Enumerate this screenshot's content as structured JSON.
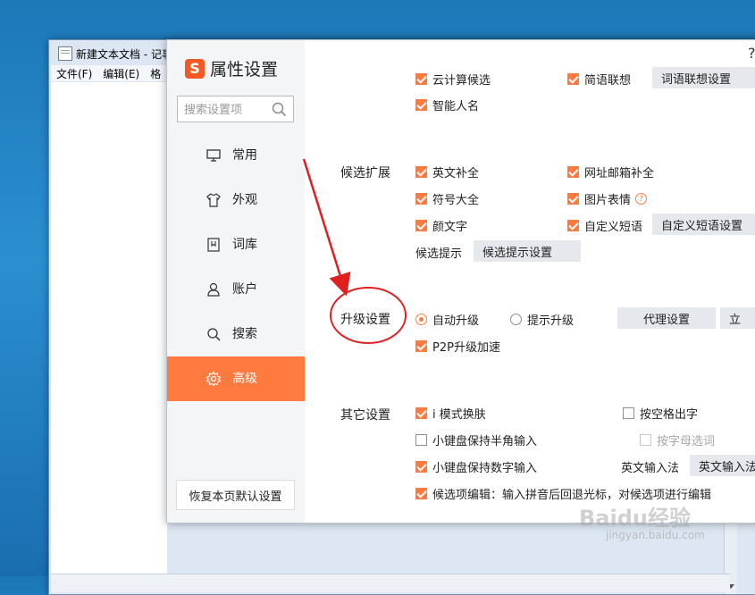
{
  "notepad": {
    "title": "新建文本文档 - 记事",
    "menu": [
      "文件(F)",
      "编辑(E)",
      "格"
    ]
  },
  "dialog": {
    "brand_letter": "S",
    "title": "属性设置",
    "help_glyph": "?",
    "search_placeholder": "搜索设置项",
    "nav": [
      {
        "label": "常用",
        "icon": "monitor-icon"
      },
      {
        "label": "外观",
        "icon": "shirt-icon"
      },
      {
        "label": "词库",
        "icon": "book-icon"
      },
      {
        "label": "账户",
        "icon": "user-icon"
      },
      {
        "label": "搜索",
        "icon": "search-icon"
      },
      {
        "label": "高级",
        "icon": "gear-icon",
        "active": true
      }
    ],
    "restore_label": "恢复本页默认设置"
  },
  "content": {
    "top": {
      "cut1": "云计算候选",
      "cut2": "简语联想",
      "cut_btn": "词语联想设置",
      "smart_name": "智能人名"
    },
    "candidate": {
      "label": "候选扩展",
      "english": "英文补全",
      "url_email": "网址邮箱补全",
      "symbol": "符号大全",
      "picture": "图片表情",
      "kaomoji": "颜文字",
      "custom_phrase": "自定义短语",
      "custom_phrase_btn": "自定义短语设置",
      "hint_label": "候选提示",
      "hint_btn": "候选提示设置"
    },
    "upgrade": {
      "label": "升级设置",
      "auto": "自动升级",
      "prompt": "提示升级",
      "proxy_btn": "代理设置",
      "now_btn": "立",
      "p2p": "P2P升级加速"
    },
    "other": {
      "label": "其它设置",
      "imode": "i 模式换肤",
      "space_out": "按空格出字",
      "keypad_half": "小键盘保持半角输入",
      "letter_select": "按字母选词",
      "keypad_num": "小键盘保持数字输入",
      "en_input_label": "英文输入法",
      "en_input_btn": "英文输入法",
      "candidate_edit": "候选项编辑：输入拼音后回退光标，对候选项进行编辑"
    }
  },
  "watermark": {
    "text": "Baidu经验",
    "sub": "jingyan.baidu.com"
  },
  "colors": {
    "accent": "#ff7a3f",
    "annotation": "#e02020"
  }
}
